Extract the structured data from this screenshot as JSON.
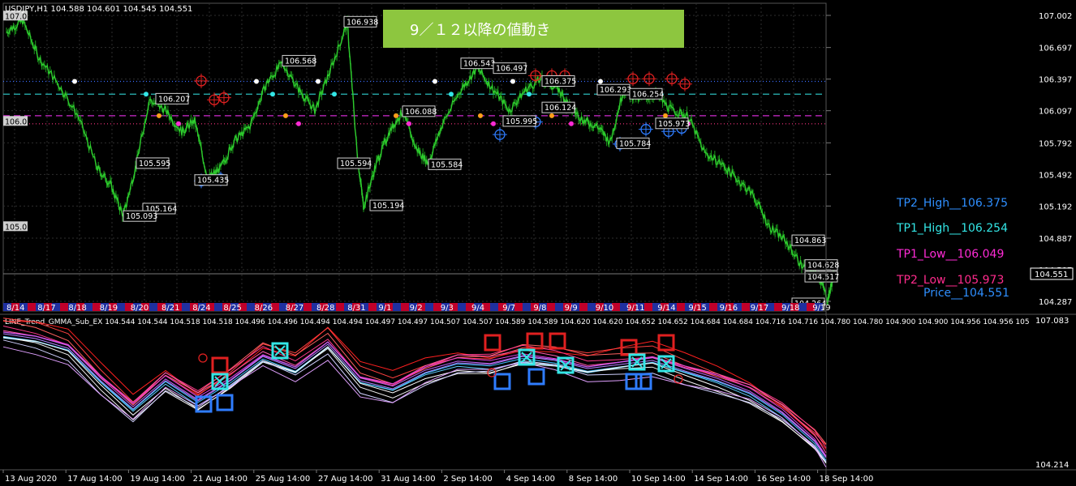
{
  "header": {
    "symbol_info": "USDJPY,H1  104.588 104.601 104.545 104.551",
    "sub_title": "LINE_Trend_GMMA_Sub_EX 104.544 104.544 104.518 104.518 104.496 104.496 104.494 104.494 104.497 104.497 104.507 104.507 104.589 104.589 104.620 104.620 104.652 104.652 104.684 104.684 104.716 104.716 104.780 104.780 104.900 104.900 104.956 104.956 105"
  },
  "banner": {
    "text": "9／１２以降の値動き",
    "bg_color": "#8dc63f"
  },
  "price_axis": {
    "ticks": [
      "107.002",
      "106.697",
      "106.397",
      "106.097",
      "105.792",
      "105.492",
      "105.192",
      "104.887",
      "104.587",
      "104.287"
    ],
    "current_price": "104.551"
  },
  "sub_axis": {
    "top": "107.083",
    "bottom": "104.214"
  },
  "level_tags": [
    "107.0",
    "106.0",
    "105.0"
  ],
  "date_strip": [
    "8/14",
    "8/17",
    "8/18",
    "8/19",
    "8/20",
    "8/21",
    "8/24",
    "8/25",
    "8/26",
    "8/27",
    "8/28",
    "8/31",
    "9/1",
    "9/2",
    "9/3",
    "9/4",
    "9/7",
    "9/8",
    "9/9",
    "9/10",
    "9/11",
    "9/14",
    "9/15",
    "9/16",
    "9/17",
    "9/18",
    "9/19"
  ],
  "time_axis": [
    "13 Aug 2020",
    "17 Aug 14:00",
    "19 Aug 14:00",
    "21 Aug 14:00",
    "25 Aug 14:00",
    "27 Aug 14:00",
    "31 Aug 14:00",
    "2 Sep 14:00",
    "4 Sep 14:00",
    "8 Sep 14:00",
    "10 Sep 14:00",
    "14 Sep 14:00",
    "16 Sep 14:00",
    "18 Sep 14:00"
  ],
  "tp_legend": [
    {
      "label": "TP2_High__106.375",
      "color": "#2f8fff"
    },
    {
      "label": "TP1_High__106.254",
      "color": "#33e6e6"
    },
    {
      "label": "TP1_Low__106.049",
      "color": "#ff2bd6"
    },
    {
      "label": "TP2_Low__105.973",
      "color": "#ff2b8c"
    },
    {
      "label": "Price__104.551",
      "color": "#2f8fff"
    }
  ],
  "chart_data": {
    "type": "line",
    "symbol": "USDJPY",
    "timeframe": "H1",
    "ylim": [
      104.2,
      107.05
    ],
    "x": [
      "8/14",
      "8/17",
      "8/18",
      "8/19",
      "8/20",
      "8/21",
      "8/24",
      "8/25",
      "8/26",
      "8/27",
      "8/28",
      "8/31",
      "9/1",
      "9/2",
      "9/3",
      "9/4",
      "9/7",
      "9/8",
      "9/9",
      "9/10",
      "9/11",
      "9/14",
      "9/15",
      "9/16",
      "9/17",
      "9/18"
    ],
    "price_path": [
      [
        0,
        106.85
      ],
      [
        0.5,
        106.95
      ],
      [
        1.0,
        106.6
      ],
      [
        1.6,
        106.35
      ],
      [
        2.2,
        106.05
      ],
      [
        2.8,
        105.55
      ],
      [
        3.2,
        105.4
      ],
      [
        3.6,
        105.1
      ],
      [
        4.0,
        105.59
      ],
      [
        4.4,
        106.2
      ],
      [
        4.9,
        106.1
      ],
      [
        5.4,
        105.9
      ],
      [
        5.8,
        106.0
      ],
      [
        6.2,
        105.45
      ],
      [
        6.6,
        105.55
      ],
      [
        7.0,
        105.8
      ],
      [
        7.5,
        105.95
      ],
      [
        8.0,
        106.35
      ],
      [
        8.5,
        106.55
      ],
      [
        9.0,
        106.3
      ],
      [
        9.5,
        106.1
      ],
      [
        10.0,
        106.5
      ],
      [
        10.5,
        106.93
      ],
      [
        10.8,
        105.7
      ],
      [
        11.0,
        105.19
      ],
      [
        11.4,
        105.6
      ],
      [
        11.8,
        105.9
      ],
      [
        12.2,
        106.09
      ],
      [
        12.6,
        105.75
      ],
      [
        13.0,
        105.6
      ],
      [
        13.4,
        105.95
      ],
      [
        14.0,
        106.3
      ],
      [
        14.5,
        106.5
      ],
      [
        15.0,
        106.3
      ],
      [
        15.5,
        106.1
      ],
      [
        16.0,
        106.3
      ],
      [
        16.5,
        106.4
      ],
      [
        17.0,
        106.3
      ],
      [
        17.4,
        106.12
      ],
      [
        17.8,
        106.0
      ],
      [
        18.2,
        105.95
      ],
      [
        18.6,
        105.8
      ],
      [
        19.0,
        106.29
      ],
      [
        19.5,
        106.2
      ],
      [
        20.0,
        106.25
      ],
      [
        20.5,
        106.1
      ],
      [
        21.0,
        106.05
      ],
      [
        21.5,
        105.7
      ],
      [
        22.0,
        105.6
      ],
      [
        22.5,
        105.45
      ],
      [
        23.0,
        105.3
      ],
      [
        23.5,
        105.0
      ],
      [
        24.0,
        104.86
      ],
      [
        24.5,
        104.63
      ],
      [
        25.0,
        104.55
      ],
      [
        25.3,
        104.3
      ],
      [
        25.5,
        104.55
      ]
    ],
    "labels": [
      {
        "x": 10.4,
        "y": 106.938,
        "text": "106.938"
      },
      {
        "x": 8.5,
        "y": 106.568,
        "text": "106.568"
      },
      {
        "x": 14.0,
        "y": 106.543,
        "text": "106.543"
      },
      {
        "x": 15.0,
        "y": 106.497,
        "text": "106.497"
      },
      {
        "x": 16.5,
        "y": 106.375,
        "text": "106.375"
      },
      {
        "x": 18.2,
        "y": 106.293,
        "text": "106.293"
      },
      {
        "x": 19.2,
        "y": 106.254,
        "text": "106.254"
      },
      {
        "x": 4.6,
        "y": 106.207,
        "text": "106.207"
      },
      {
        "x": 16.5,
        "y": 106.124,
        "text": "106.124"
      },
      {
        "x": 12.2,
        "y": 106.088,
        "text": "106.088"
      },
      {
        "x": 15.3,
        "y": 105.995,
        "text": "105.995"
      },
      {
        "x": 20.0,
        "y": 105.973,
        "text": "105.973"
      },
      {
        "x": 18.8,
        "y": 105.784,
        "text": "105.784"
      },
      {
        "x": 4.0,
        "y": 105.595,
        "text": "105.595"
      },
      {
        "x": 10.2,
        "y": 105.594,
        "text": "105.594"
      },
      {
        "x": 13.0,
        "y": 105.584,
        "text": "105.584"
      },
      {
        "x": 5.8,
        "y": 105.435,
        "text": "105.435"
      },
      {
        "x": 11.2,
        "y": 105.194,
        "text": "105.194"
      },
      {
        "x": 4.2,
        "y": 105.164,
        "text": "105.164"
      },
      {
        "x": 3.6,
        "y": 105.093,
        "text": "105.093"
      },
      {
        "x": 24.2,
        "y": 104.863,
        "text": "104.863"
      },
      {
        "x": 24.6,
        "y": 104.628,
        "text": "104.628"
      },
      {
        "x": 24.6,
        "y": 104.517,
        "text": "104.517"
      },
      {
        "x": 24.2,
        "y": 104.264,
        "text": "104.264"
      }
    ],
    "levels": [
      {
        "name": "TP2_High",
        "value": 106.375
      },
      {
        "name": "TP1_High",
        "value": 106.254
      },
      {
        "name": "TP1_Low",
        "value": 106.049
      },
      {
        "name": "TP2_Low",
        "value": 105.973
      }
    ],
    "price": 104.551,
    "grid": true
  },
  "colors": {
    "price_line": "#22b322",
    "grid": "#3a3a3a",
    "text": "#ffffff",
    "label_border": "#d0d0d0"
  }
}
